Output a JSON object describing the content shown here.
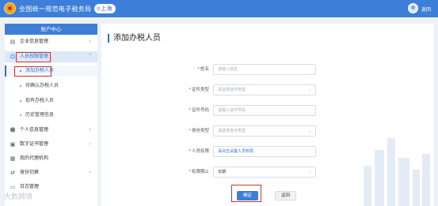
{
  "header": {
    "site_title": "全国统一规范电子税务局",
    "region": "上海",
    "user_name": "返回"
  },
  "sidebar": {
    "title": "账户中心",
    "items": [
      {
        "label": "企业信息管理",
        "icon": "building-icon"
      },
      {
        "label": "人员权限管理",
        "icon": "people-icon"
      },
      {
        "label": "个人信息管理",
        "icon": "person-icon"
      },
      {
        "label": "数字证书管理",
        "icon": "certificate-icon"
      },
      {
        "label": "我的代理机构",
        "icon": "agency-icon"
      },
      {
        "label": "身份切换",
        "icon": "switch-icon"
      },
      {
        "label": "日志管理",
        "icon": "log-icon"
      }
    ],
    "sub_items": [
      "添加办税人员",
      "待确认办税人员",
      "现有办税人员",
      "历史管理信息"
    ]
  },
  "main": {
    "title": "添加办税人员",
    "form": {
      "fields": [
        {
          "label": "姓名",
          "value": "请输入姓名",
          "required": true
        },
        {
          "label": "证件类型",
          "value": "请选择证件类型",
          "required": true
        },
        {
          "label": "证件号码",
          "value": "请输入证件号码",
          "required": true
        },
        {
          "label": "身份类型",
          "value": "请选择身份类型",
          "required": true
        },
        {
          "label": "人员权限",
          "value": "请点击设置人员权限",
          "required": true
        },
        {
          "label": "权限期止",
          "value": "长期",
          "required": true
        }
      ]
    },
    "buttons": {
      "confirm": "确定",
      "return": "返回"
    }
  },
  "watermark": "大数跨境",
  "colors": {
    "brand": "#3d7fd8",
    "highlight": "#c0392b"
  }
}
